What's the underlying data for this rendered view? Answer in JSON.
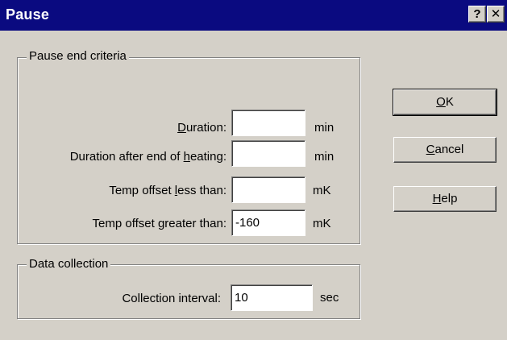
{
  "window": {
    "title": "Pause",
    "help_glyph": "?",
    "close_glyph": "✕"
  },
  "pause_group": {
    "title": "Pause end criteria",
    "rows": [
      {
        "label_pre": "",
        "label_key": "D",
        "label_post": "uration:",
        "value": "",
        "unit": "min"
      },
      {
        "label_pre": "Duration after end of ",
        "label_key": "h",
        "label_post": "eating:",
        "value": "",
        "unit": "min"
      },
      {
        "label_pre": "Temp offset ",
        "label_key": "l",
        "label_post": "ess than:",
        "value": "",
        "unit": "mK"
      },
      {
        "label_pre": "Temp offset ",
        "label_key": "g",
        "label_post": "reater than:",
        "value": "-160",
        "unit": "mK"
      }
    ]
  },
  "data_group": {
    "title": "Data collection",
    "label": "Collection interval:",
    "value": "10",
    "unit": "sec"
  },
  "buttons": {
    "ok_key": "O",
    "ok_rest": "K",
    "cancel_key": "C",
    "cancel_rest": "ancel",
    "help_key": "H",
    "help_rest": "elp"
  }
}
